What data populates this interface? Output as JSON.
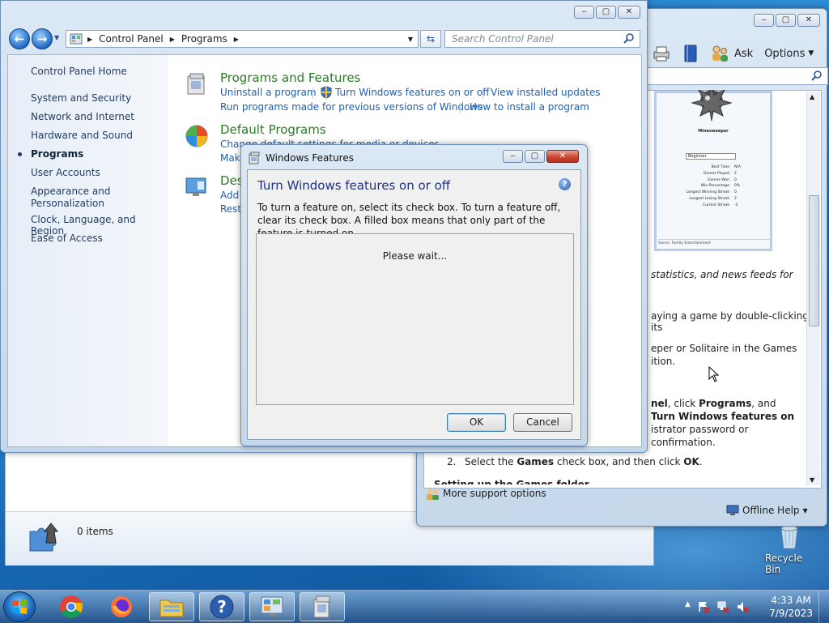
{
  "desktop": {
    "recycle_bin_label": "Recycle Bin"
  },
  "help_window": {
    "toolbar_ask": "Ask",
    "toolbar_options": "Options",
    "minesweeper_title": "Minesweeper",
    "minesweeper_select": "Beginner",
    "minesweeper_stats": [
      "Best Time",
      "Games Played",
      "Games Won",
      "Win Percentage",
      "Longest Winning Streak",
      "Longest Losing Streak",
      "Current Streak"
    ],
    "minesweeper_values": [
      "N/A",
      "2",
      "0",
      "0%",
      "0",
      "2",
      "-2"
    ],
    "minesweeper_footer": "Genre: Family Entertainment",
    "lines": {
      "l1": "statistics, and news feeds for",
      "l2": "aying a game by double-clicking its",
      "l3": "eper or Solitaire in the Games",
      "l4": "ition.",
      "l5a": "nel",
      "l5b": ", click ",
      "l5c": "Programs",
      "l5d": ", and",
      "l6": "Turn Windows features on",
      "l7": "istrator password or",
      "l8": "confirmation.",
      "step2_num": "2.",
      "step2_a": "Select the ",
      "step2_b": "Games",
      "step2_c": " check box, and then click ",
      "step2_d": "OK",
      "step2_e": ".",
      "cut_heading": "Setting up the Games folder"
    },
    "more_support": "More support options",
    "offline_help": "Offline Help"
  },
  "explorer_behind": {
    "items_count": "0 items"
  },
  "control_panel": {
    "breadcrumb": [
      "Control Panel",
      "Programs"
    ],
    "search_placeholder": "Search Control Panel",
    "nav": [
      "Control Panel Home",
      "System and Security",
      "Network and Internet",
      "Hardware and Sound",
      "Programs",
      "User Accounts",
      "Appearance and",
      "Personalization",
      "Clock, Language, and Region",
      "Ease of Access"
    ],
    "categories": {
      "programs_features": {
        "title": "Programs and Features",
        "links": [
          "Uninstall a program",
          "Turn Windows features on or off",
          "View installed updates",
          "Run programs made for previous versions of Windows",
          "How to install a program"
        ]
      },
      "default_programs": {
        "title": "Default Programs",
        "links": [
          "Change default settings for media or devices",
          "Make"
        ]
      },
      "desktop_gadgets": {
        "title": "Des",
        "links": [
          "Add",
          "Resto"
        ]
      }
    }
  },
  "dialog": {
    "title": "Windows Features",
    "heading": "Turn Windows features on or off",
    "description": "To turn a feature on, select its check box. To turn a feature off, clear its check box. A filled box means that only part of the feature is turned on.",
    "wait_text": "Please wait...",
    "ok_label": "OK",
    "cancel_label": "Cancel"
  },
  "taskbar": {
    "time": "4:33 AM",
    "date": "7/9/2023"
  }
}
